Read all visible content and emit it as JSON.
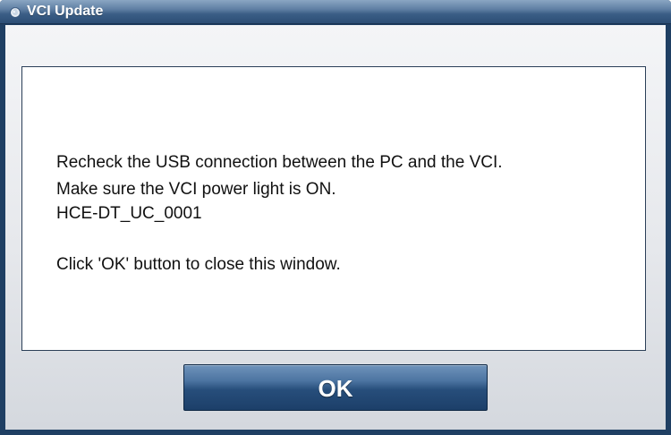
{
  "window": {
    "title": "VCI Update",
    "title_icon": "app-drop-icon",
    "frame_color": "#1f3f63"
  },
  "message": {
    "lines": [
      "Recheck the USB connection between the PC and the VCI.",
      "Make sure the VCI power light is ON.",
      "HCE-DT_UC_0001",
      "",
      "Click 'OK' button to close this window."
    ]
  },
  "buttons": {
    "ok_label": "OK",
    "ok_color": "#274e7b"
  }
}
